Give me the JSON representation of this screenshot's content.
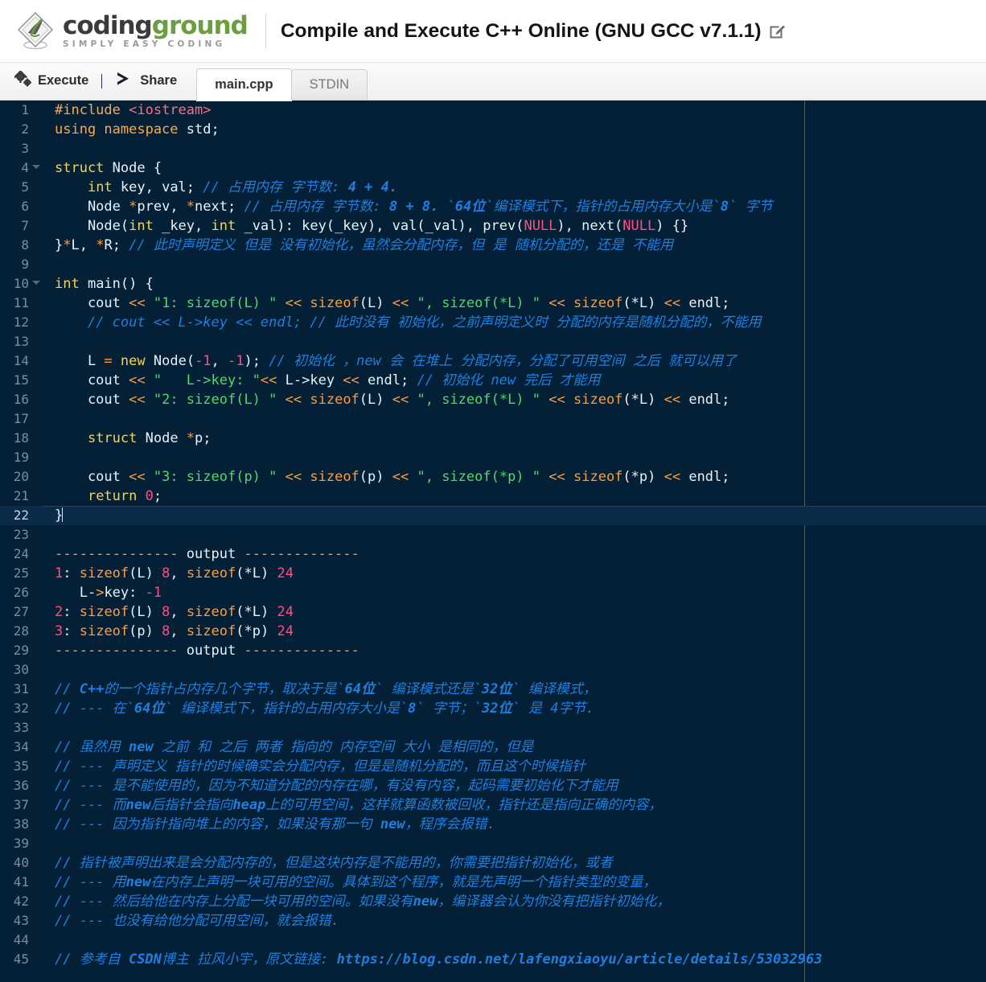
{
  "header": {
    "logo": {
      "icon": "codingground-diamond-logo",
      "word1": "coding",
      "word2": "ground",
      "tagline": "SIMPLY EASY CODING"
    },
    "title": "Compile and Execute C++ Online (GNU GCC v7.1.1)",
    "edit_icon": "pencil-edit-icon"
  },
  "toolbar": {
    "execute_label": "Execute",
    "execute_icon": "gears-icon",
    "share_label": "Share",
    "share_icon": "share-arrow-icon",
    "tabs": [
      {
        "label": "main.cpp",
        "active": true
      },
      {
        "label": "STDIN",
        "active": false
      }
    ]
  },
  "editor": {
    "active_line": 22,
    "total_lines": 45,
    "colors": {
      "background": "#042037",
      "active_line": "#0a2c48",
      "gutter_text": "#7c8c9c",
      "keyword": "#f4d44f",
      "directive": "#ffa74d",
      "string": "#4ddb6a",
      "number": "#ff4f81",
      "operator": "#ff9d3c",
      "comment": "#1e7fe0",
      "plain": "#e8f2f7",
      "ruler": "#5c6b62"
    },
    "fold_lines": [
      4,
      10
    ],
    "lines": [
      {
        "n": 1,
        "tokens": [
          {
            "t": "kw2",
            "v": "#include"
          },
          {
            "t": "pl",
            "v": " "
          },
          {
            "t": "inc",
            "v": "<iostream>"
          }
        ]
      },
      {
        "n": 2,
        "tokens": [
          {
            "t": "kw2",
            "v": "using namespace"
          },
          {
            "t": "pl",
            "v": " std;"
          }
        ]
      },
      {
        "n": 3,
        "tokens": []
      },
      {
        "n": 4,
        "tokens": [
          {
            "t": "k",
            "v": "struct"
          },
          {
            "t": "pl",
            "v": " Node {"
          }
        ]
      },
      {
        "n": 5,
        "tokens": [
          {
            "t": "pl",
            "v": "    "
          },
          {
            "t": "k",
            "v": "int"
          },
          {
            "t": "pl",
            "v": " key, val; "
          },
          {
            "t": "cm",
            "v": "// 占用内存 字节数: "
          },
          {
            "t": "cmb",
            "v": "4 + 4."
          }
        ]
      },
      {
        "n": 6,
        "tokens": [
          {
            "t": "pl",
            "v": "    Node "
          },
          {
            "t": "op",
            "v": "*"
          },
          {
            "t": "pl",
            "v": "prev, "
          },
          {
            "t": "op",
            "v": "*"
          },
          {
            "t": "pl",
            "v": "next; "
          },
          {
            "t": "cm",
            "v": "// 占用内存 字节数: "
          },
          {
            "t": "cmb",
            "v": "8 + 8."
          },
          {
            "t": "cm",
            "v": " `"
          },
          {
            "t": "cmb",
            "v": "64位"
          },
          {
            "t": "cm",
            "v": "`编译模式下，指针的占用内存大小是`"
          },
          {
            "t": "cmb",
            "v": "8"
          },
          {
            "t": "cm",
            "v": "` 字节"
          }
        ]
      },
      {
        "n": 7,
        "tokens": [
          {
            "t": "pl",
            "v": "    Node("
          },
          {
            "t": "k",
            "v": "int"
          },
          {
            "t": "pl",
            "v": " _key, "
          },
          {
            "t": "k",
            "v": "int"
          },
          {
            "t": "pl",
            "v": " _val): key(_key), val(_val), prev("
          },
          {
            "t": "num",
            "v": "NULL"
          },
          {
            "t": "pl",
            "v": "), next("
          },
          {
            "t": "num",
            "v": "NULL"
          },
          {
            "t": "pl",
            "v": ") {}"
          }
        ]
      },
      {
        "n": 8,
        "tokens": [
          {
            "t": "pl",
            "v": "}"
          },
          {
            "t": "op",
            "v": "*"
          },
          {
            "t": "pl",
            "v": "L, "
          },
          {
            "t": "op",
            "v": "*"
          },
          {
            "t": "pl",
            "v": "R; "
          },
          {
            "t": "cm",
            "v": "// 此时声明定义 但是 没有初始化，虽然会分配内存，但 是 随机分配的，还是 不能用"
          }
        ]
      },
      {
        "n": 9,
        "tokens": []
      },
      {
        "n": 10,
        "tokens": [
          {
            "t": "k",
            "v": "int"
          },
          {
            "t": "pl",
            "v": " main() {"
          }
        ]
      },
      {
        "n": 11,
        "tokens": [
          {
            "t": "pl",
            "v": "    cout "
          },
          {
            "t": "op",
            "v": "<<"
          },
          {
            "t": "pl",
            "v": " "
          },
          {
            "t": "str",
            "v": "\"1: sizeof(L) \""
          },
          {
            "t": "pl",
            "v": " "
          },
          {
            "t": "op",
            "v": "<<"
          },
          {
            "t": "pl",
            "v": " "
          },
          {
            "t": "op",
            "v": "sizeof"
          },
          {
            "t": "pl",
            "v": "(L) "
          },
          {
            "t": "op",
            "v": "<<"
          },
          {
            "t": "pl",
            "v": " "
          },
          {
            "t": "str",
            "v": "\", sizeof(*L) \""
          },
          {
            "t": "pl",
            "v": " "
          },
          {
            "t": "op",
            "v": "<<"
          },
          {
            "t": "pl",
            "v": " "
          },
          {
            "t": "op",
            "v": "sizeof"
          },
          {
            "t": "pl",
            "v": "(*L) "
          },
          {
            "t": "op",
            "v": "<<"
          },
          {
            "t": "pl",
            "v": " endl;"
          }
        ]
      },
      {
        "n": 12,
        "tokens": [
          {
            "t": "pl",
            "v": "    "
          },
          {
            "t": "cm",
            "v": "// cout << L->key << endl; // 此时没有 初始化，之前声明定义时 分配的内存是随机分配的，不能用"
          }
        ]
      },
      {
        "n": 13,
        "tokens": []
      },
      {
        "n": 14,
        "tokens": [
          {
            "t": "pl",
            "v": "    L "
          },
          {
            "t": "op",
            "v": "="
          },
          {
            "t": "pl",
            "v": " "
          },
          {
            "t": "k",
            "v": "new"
          },
          {
            "t": "pl",
            "v": " Node("
          },
          {
            "t": "num",
            "v": "-1"
          },
          {
            "t": "pl",
            "v": ", "
          },
          {
            "t": "num",
            "v": "-1"
          },
          {
            "t": "pl",
            "v": "); "
          },
          {
            "t": "cm",
            "v": "// 初始化 ，new 会 在堆上 分配内存，分配了可用空间 之后 就可以用了"
          }
        ]
      },
      {
        "n": 15,
        "tokens": [
          {
            "t": "pl",
            "v": "    cout "
          },
          {
            "t": "op",
            "v": "<<"
          },
          {
            "t": "pl",
            "v": " "
          },
          {
            "t": "str",
            "v": "\"   L->key: \""
          },
          {
            "t": "op",
            "v": "<<"
          },
          {
            "t": "pl",
            "v": " L->key "
          },
          {
            "t": "op",
            "v": "<<"
          },
          {
            "t": "pl",
            "v": " endl; "
          },
          {
            "t": "cm",
            "v": "// 初始化 new 完后 才能用"
          }
        ]
      },
      {
        "n": 16,
        "tokens": [
          {
            "t": "pl",
            "v": "    cout "
          },
          {
            "t": "op",
            "v": "<<"
          },
          {
            "t": "pl",
            "v": " "
          },
          {
            "t": "str",
            "v": "\"2: sizeof(L) \""
          },
          {
            "t": "pl",
            "v": " "
          },
          {
            "t": "op",
            "v": "<<"
          },
          {
            "t": "pl",
            "v": " "
          },
          {
            "t": "op",
            "v": "sizeof"
          },
          {
            "t": "pl",
            "v": "(L) "
          },
          {
            "t": "op",
            "v": "<<"
          },
          {
            "t": "pl",
            "v": " "
          },
          {
            "t": "str",
            "v": "\", sizeof(*L) \""
          },
          {
            "t": "pl",
            "v": " "
          },
          {
            "t": "op",
            "v": "<<"
          },
          {
            "t": "pl",
            "v": " "
          },
          {
            "t": "op",
            "v": "sizeof"
          },
          {
            "t": "pl",
            "v": "(*L) "
          },
          {
            "t": "op",
            "v": "<<"
          },
          {
            "t": "pl",
            "v": " endl;"
          }
        ]
      },
      {
        "n": 17,
        "tokens": []
      },
      {
        "n": 18,
        "tokens": [
          {
            "t": "pl",
            "v": "    "
          },
          {
            "t": "k",
            "v": "struct"
          },
          {
            "t": "pl",
            "v": " Node "
          },
          {
            "t": "op",
            "v": "*"
          },
          {
            "t": "pl",
            "v": "p;"
          }
        ]
      },
      {
        "n": 19,
        "tokens": []
      },
      {
        "n": 20,
        "tokens": [
          {
            "t": "pl",
            "v": "    cout "
          },
          {
            "t": "op",
            "v": "<<"
          },
          {
            "t": "pl",
            "v": " "
          },
          {
            "t": "str",
            "v": "\"3: sizeof(p) \""
          },
          {
            "t": "pl",
            "v": " "
          },
          {
            "t": "op",
            "v": "<<"
          },
          {
            "t": "pl",
            "v": " "
          },
          {
            "t": "op",
            "v": "sizeof"
          },
          {
            "t": "pl",
            "v": "(p) "
          },
          {
            "t": "op",
            "v": "<<"
          },
          {
            "t": "pl",
            "v": " "
          },
          {
            "t": "str",
            "v": "\", sizeof(*p) \""
          },
          {
            "t": "pl",
            "v": " "
          },
          {
            "t": "op",
            "v": "<<"
          },
          {
            "t": "pl",
            "v": " "
          },
          {
            "t": "op",
            "v": "sizeof"
          },
          {
            "t": "pl",
            "v": "(*p) "
          },
          {
            "t": "op",
            "v": "<<"
          },
          {
            "t": "pl",
            "v": " endl;"
          }
        ]
      },
      {
        "n": 21,
        "tokens": [
          {
            "t": "pl",
            "v": "    "
          },
          {
            "t": "k",
            "v": "return"
          },
          {
            "t": "pl",
            "v": " "
          },
          {
            "t": "num",
            "v": "0"
          },
          {
            "t": "pl",
            "v": ";"
          }
        ]
      },
      {
        "n": 22,
        "tokens": [
          {
            "t": "pl",
            "v": "}"
          }
        ],
        "cursor": true
      },
      {
        "n": 23,
        "tokens": []
      },
      {
        "n": 24,
        "tokens": [
          {
            "t": "out-dash",
            "v": "--------------- "
          },
          {
            "t": "pl",
            "v": "output"
          },
          {
            "t": "out-dash",
            "v": " --------------"
          }
        ]
      },
      {
        "n": 25,
        "tokens": [
          {
            "t": "num",
            "v": "1"
          },
          {
            "t": "pl",
            "v": ": "
          },
          {
            "t": "op",
            "v": "sizeof"
          },
          {
            "t": "pl",
            "v": "(L) "
          },
          {
            "t": "num",
            "v": "8"
          },
          {
            "t": "pl",
            "v": ", "
          },
          {
            "t": "op",
            "v": "sizeof"
          },
          {
            "t": "pl",
            "v": "(*L) "
          },
          {
            "t": "num",
            "v": "24"
          }
        ]
      },
      {
        "n": 26,
        "tokens": [
          {
            "t": "pl",
            "v": "   L-"
          },
          {
            "t": "op",
            "v": ">"
          },
          {
            "t": "pl",
            "v": "key: "
          },
          {
            "t": "num",
            "v": "-1"
          }
        ]
      },
      {
        "n": 27,
        "tokens": [
          {
            "t": "num",
            "v": "2"
          },
          {
            "t": "pl",
            "v": ": "
          },
          {
            "t": "op",
            "v": "sizeof"
          },
          {
            "t": "pl",
            "v": "(L) "
          },
          {
            "t": "num",
            "v": "8"
          },
          {
            "t": "pl",
            "v": ", "
          },
          {
            "t": "op",
            "v": "sizeof"
          },
          {
            "t": "pl",
            "v": "(*L) "
          },
          {
            "t": "num",
            "v": "24"
          }
        ]
      },
      {
        "n": 28,
        "tokens": [
          {
            "t": "num",
            "v": "3"
          },
          {
            "t": "pl",
            "v": ": "
          },
          {
            "t": "op",
            "v": "sizeof"
          },
          {
            "t": "pl",
            "v": "(p) "
          },
          {
            "t": "num",
            "v": "8"
          },
          {
            "t": "pl",
            "v": ", "
          },
          {
            "t": "op",
            "v": "sizeof"
          },
          {
            "t": "pl",
            "v": "(*p) "
          },
          {
            "t": "num",
            "v": "24"
          }
        ]
      },
      {
        "n": 29,
        "tokens": [
          {
            "t": "out-dash",
            "v": "--------------- "
          },
          {
            "t": "pl",
            "v": "output"
          },
          {
            "t": "out-dash",
            "v": " --------------"
          }
        ]
      },
      {
        "n": 30,
        "tokens": []
      },
      {
        "n": 31,
        "tokens": [
          {
            "t": "cm",
            "v": "// "
          },
          {
            "t": "cmb",
            "v": "C++"
          },
          {
            "t": "cm",
            "v": "的一个指针占内存几个字节，取决于是`"
          },
          {
            "t": "cmb",
            "v": "64位"
          },
          {
            "t": "cm",
            "v": "` 编译模式还是`"
          },
          {
            "t": "cmb",
            "v": "32位"
          },
          {
            "t": "cm",
            "v": "` 编译模式，"
          }
        ]
      },
      {
        "n": 32,
        "tokens": [
          {
            "t": "cm",
            "v": "// --- 在`"
          },
          {
            "t": "cmb",
            "v": "64位"
          },
          {
            "t": "cm",
            "v": "` 编译模式下，指针的占用内存大小是`"
          },
          {
            "t": "cmb",
            "v": "8"
          },
          {
            "t": "cm",
            "v": "` 字节；`"
          },
          {
            "t": "cmb",
            "v": "32位"
          },
          {
            "t": "cm",
            "v": "` 是 4字节."
          }
        ]
      },
      {
        "n": 33,
        "tokens": []
      },
      {
        "n": 34,
        "tokens": [
          {
            "t": "cm",
            "v": "// 虽然用 "
          },
          {
            "t": "cmb",
            "v": "new"
          },
          {
            "t": "cm",
            "v": " 之前 和 之后 两者 指向的 内存空间 大小 是相同的，但是"
          }
        ]
      },
      {
        "n": 35,
        "tokens": [
          {
            "t": "cm",
            "v": "// --- 声明定义 指针的时候确实会分配内存，但是是随机分配的，而且这个时候指针"
          }
        ]
      },
      {
        "n": 36,
        "tokens": [
          {
            "t": "cm",
            "v": "// --- 是不能使用的，因为不知道分配的内存在哪，有没有内容，起码需要初始化下才能用"
          }
        ]
      },
      {
        "n": 37,
        "tokens": [
          {
            "t": "cm",
            "v": "// --- 而"
          },
          {
            "t": "cmb",
            "v": "new"
          },
          {
            "t": "cm",
            "v": "后指针会指向"
          },
          {
            "t": "cmb",
            "v": "heap"
          },
          {
            "t": "cm",
            "v": "上的可用空间，这样就算函数被回收，指针还是指向正确的内容，"
          }
        ]
      },
      {
        "n": 38,
        "tokens": [
          {
            "t": "cm",
            "v": "// --- 因为指针指向堆上的内容，如果没有那一句 "
          },
          {
            "t": "cmb",
            "v": "new"
          },
          {
            "t": "cm",
            "v": "，程序会报错."
          }
        ]
      },
      {
        "n": 39,
        "tokens": []
      },
      {
        "n": 40,
        "tokens": [
          {
            "t": "cm",
            "v": "// 指针被声明出来是会分配内存的，但是这块内存是不能用的，你需要把指针初始化，或者"
          }
        ]
      },
      {
        "n": 41,
        "tokens": [
          {
            "t": "cm",
            "v": "// --- 用"
          },
          {
            "t": "cmb",
            "v": "new"
          },
          {
            "t": "cm",
            "v": "在内存上声明一块可用的空间。具体到这个程序，就是先声明一个指针类型的变量，"
          }
        ]
      },
      {
        "n": 42,
        "tokens": [
          {
            "t": "cm",
            "v": "// --- 然后给他在内存上分配一块可用的空间。如果没有"
          },
          {
            "t": "cmb",
            "v": "new"
          },
          {
            "t": "cm",
            "v": "，编译器会认为你没有把指针初始化，"
          }
        ]
      },
      {
        "n": 43,
        "tokens": [
          {
            "t": "cm",
            "v": "// --- 也没有给他分配可用空间，就会报错."
          }
        ]
      },
      {
        "n": 44,
        "tokens": []
      },
      {
        "n": 45,
        "tokens": [
          {
            "t": "cm",
            "v": "// 参考自 "
          },
          {
            "t": "cmb",
            "v": "CSDN"
          },
          {
            "t": "cm",
            "v": "博主 拉风小宇，原文链接: "
          },
          {
            "t": "cmb",
            "v": "https://blog.csdn.net/lafengxiaoyu/article/details/53032963"
          }
        ]
      }
    ]
  }
}
